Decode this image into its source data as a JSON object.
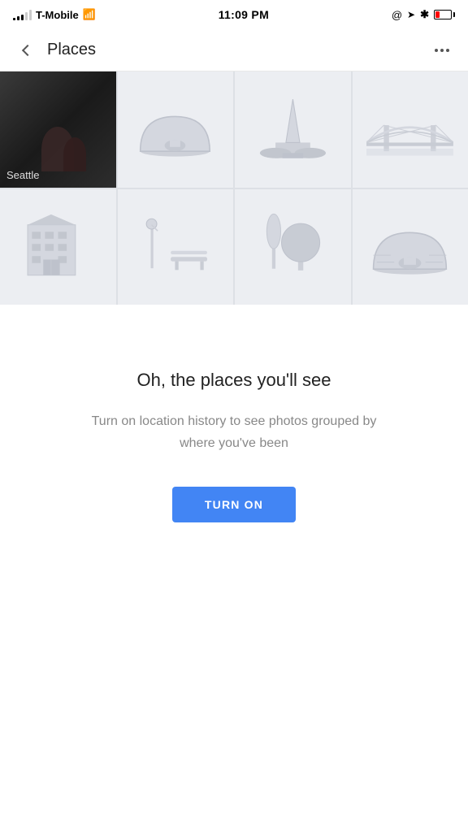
{
  "statusBar": {
    "carrier": "T-Mobile",
    "time": "11:09 PM",
    "signals": [
      2,
      4,
      6,
      8,
      10
    ],
    "battery_level": "low"
  },
  "header": {
    "back_label": "back",
    "title": "Places",
    "more_label": "more options"
  },
  "grid": {
    "cells": [
      {
        "id": "seattle",
        "label": "Seattle",
        "type": "photo"
      },
      {
        "id": "igloo",
        "label": "",
        "type": "placeholder"
      },
      {
        "id": "monument",
        "label": "",
        "type": "placeholder"
      },
      {
        "id": "bridge",
        "label": "",
        "type": "placeholder"
      },
      {
        "id": "building",
        "label": "",
        "type": "placeholder"
      },
      {
        "id": "park",
        "label": "",
        "type": "placeholder"
      },
      {
        "id": "trees",
        "label": "",
        "type": "placeholder"
      },
      {
        "id": "igloo2",
        "label": "",
        "type": "placeholder"
      }
    ]
  },
  "cta": {
    "title": "Oh, the places you'll see",
    "description": "Turn on location history to see photos grouped by where you've been",
    "button_label": "TURN ON"
  }
}
